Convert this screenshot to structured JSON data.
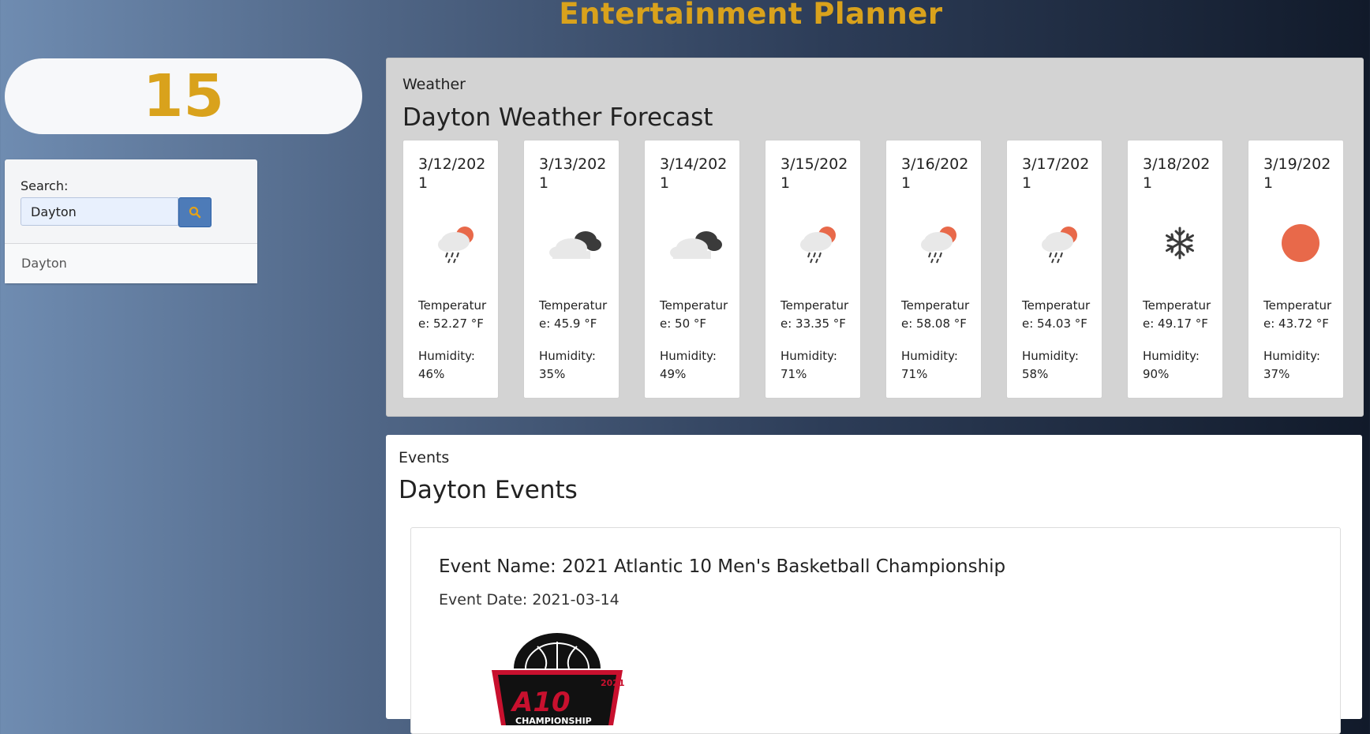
{
  "app": {
    "title": "Entertainment Planner"
  },
  "counter": {
    "value": "15"
  },
  "search": {
    "label": "Search:",
    "value": "Dayton",
    "button_icon": "search-icon",
    "history": [
      "Dayton"
    ]
  },
  "weather": {
    "tag": "Weather",
    "heading": "Dayton Weather Forecast",
    "days": [
      {
        "date": "3/12/2021",
        "icon": "rain-sun-icon",
        "temperature": "Temperature: 52.27 °F",
        "humidity": "Humidity: 46%"
      },
      {
        "date": "3/13/2021",
        "icon": "cloudy-icon",
        "temperature": "Temperature: 45.9 °F",
        "humidity": "Humidity: 35%"
      },
      {
        "date": "3/14/2021",
        "icon": "cloudy-icon",
        "temperature": "Temperature: 50 °F",
        "humidity": "Humidity: 49%"
      },
      {
        "date": "3/15/2021",
        "icon": "rain-sun-icon",
        "temperature": "Temperature: 33.35 °F",
        "humidity": "Humidity: 71%"
      },
      {
        "date": "3/16/2021",
        "icon": "rain-sun-icon",
        "temperature": "Temperature: 58.08 °F",
        "humidity": "Humidity: 71%"
      },
      {
        "date": "3/17/2021",
        "icon": "rain-sun-icon",
        "temperature": "Temperature: 54.03 °F",
        "humidity": "Humidity: 58%"
      },
      {
        "date": "3/18/2021",
        "icon": "snowflake-icon",
        "temperature": "Temperature: 49.17 °F",
        "humidity": "Humidity: 90%"
      },
      {
        "date": "3/19/2021",
        "icon": "sun-icon",
        "temperature": "Temperature: 43.72 °F",
        "humidity": "Humidity: 37%"
      }
    ]
  },
  "events": {
    "tag": "Events",
    "heading": "Dayton Events",
    "items": [
      {
        "name": "Event Name: 2021 Atlantic 10 Men's Basketball Championship",
        "date": "Event Date: 2021-03-14",
        "logo_year": "2021",
        "logo_main": "A10",
        "logo_sub": "CHAMPIONSHIP"
      }
    ]
  },
  "colors": {
    "accent": "#d9a21c",
    "search_button": "#4d7bb8",
    "weather_orange": "#e8694a",
    "cloud_dark": "#3b3b3b",
    "cloud_light": "#e8e8e8"
  }
}
